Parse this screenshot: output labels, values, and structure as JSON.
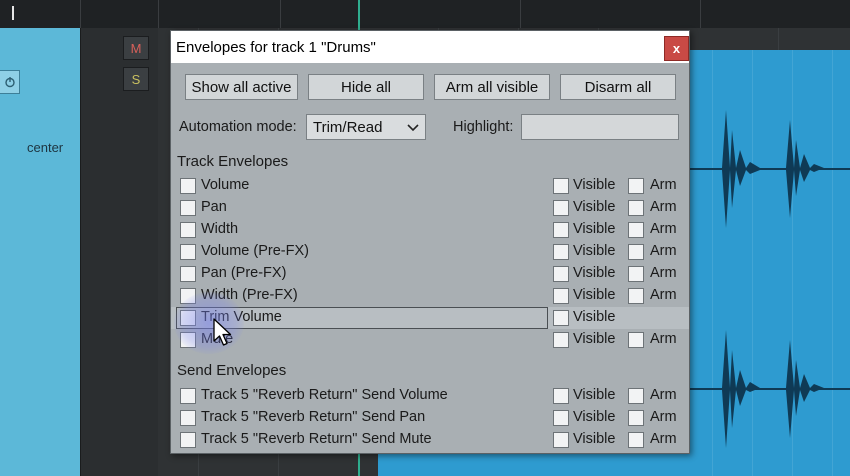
{
  "track_header": {
    "pan_label": "center",
    "mute_label": "M",
    "solo_label": "S"
  },
  "dialog": {
    "title": "Envelopes for track 1 \"Drums\"",
    "close_label": "x",
    "buttons": {
      "show_all_active": "Show all active",
      "hide_all": "Hide all",
      "arm_all_visible": "Arm all visible",
      "disarm_all": "Disarm all"
    },
    "automation_mode_label": "Automation mode:",
    "automation_mode_value": "Trim/Read",
    "highlight_label": "Highlight:",
    "highlight_value": "",
    "track_envelopes_header": "Track Envelopes",
    "track_envelopes": [
      {
        "label": "Volume",
        "visible_label": "Visible",
        "arm_label": "Arm"
      },
      {
        "label": "Pan",
        "visible_label": "Visible",
        "arm_label": "Arm"
      },
      {
        "label": "Width",
        "visible_label": "Visible",
        "arm_label": "Arm"
      },
      {
        "label": "Volume (Pre-FX)",
        "visible_label": "Visible",
        "arm_label": "Arm"
      },
      {
        "label": "Pan (Pre-FX)",
        "visible_label": "Visible",
        "arm_label": "Arm"
      },
      {
        "label": "Width (Pre-FX)",
        "visible_label": "Visible",
        "arm_label": "Arm"
      },
      {
        "label": "Trim Volume",
        "visible_label": "Visible"
      },
      {
        "label": "Mute",
        "visible_label": "Visible",
        "arm_label": "Arm"
      }
    ],
    "send_envelopes_header": "Send Envelopes",
    "send_envelopes": [
      {
        "label": "Track 5 \"Reverb Return\" Send Volume",
        "visible_label": "Visible",
        "arm_label": "Arm"
      },
      {
        "label": "Track 5 \"Reverb Return\" Send Pan",
        "visible_label": "Visible",
        "arm_label": "Arm"
      },
      {
        "label": "Track 5 \"Reverb Return\" Send Mute",
        "visible_label": "Visible",
        "arm_label": "Arm"
      }
    ]
  },
  "colors": {
    "track_color": "#5cb8d8",
    "item_color": "#2e9bd0",
    "close_button": "#c94a45",
    "dialog_bg": "#a9afb3"
  },
  "icons": {
    "power": "power-icon",
    "chevron": "chevron-down-icon",
    "pointer": "mouse-pointer-icon"
  }
}
